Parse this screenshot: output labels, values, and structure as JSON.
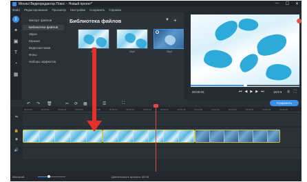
{
  "window": {
    "title": "Movavi Видеоредактор Плюс – Новый проект*",
    "controls": [
      "—",
      "☐",
      "✕"
    ]
  },
  "menu": [
    "Файл",
    "Редактирование",
    "Просмотр",
    "Настройки",
    "Сохранить",
    "Справка"
  ],
  "tools": [
    "import-icon",
    "magic-wand-icon",
    "filters-icon",
    "titles-icon",
    "transitions-icon",
    "stickers-icon"
  ],
  "categories": {
    "items": [
      "Импорт файлов",
      "Библиотека файлов",
      "Звуки",
      "Музыка",
      "Видеозаставки",
      "Фоны",
      "Наборы эффектов"
    ],
    "active_index": 1
  },
  "library": {
    "title": "Библиотека файлов",
    "filter_glyph": "▼",
    "add_glyph": "+",
    "items": [
      {
        "label": "Clip1",
        "selected": false
      },
      {
        "label": "Clip2",
        "selected": false
      },
      {
        "label": "Clip3",
        "selected": true
      }
    ]
  },
  "preview": {
    "timecode": "00:00:02.",
    "transport": [
      "⏮",
      "◀",
      "▶",
      "▶",
      "⏭"
    ],
    "aspect_ratio": "16:9 ▾",
    "position_fraction": 0.5
  },
  "timeline_toolbar": {
    "tools": [
      "↶",
      "↷",
      "🗑",
      "✂",
      "⟳",
      "▦",
      "◐",
      "☰",
      "⛶"
    ],
    "save_label": "Сохранить"
  },
  "ruler": {
    "ticks": [
      "00:00:00",
      "00:00:02",
      "00:00:04",
      "00:00:06",
      "00:00:08",
      "00:00:10",
      "00:00:12",
      "00:00:14",
      "00:00:16",
      "00:00:18",
      "00:00:20",
      "00:00:22",
      "00:00:24",
      "00:00:26",
      "00:00:28",
      "00:00:30"
    ]
  },
  "statusbar": {
    "zoom_label": "Масштаб:",
    "zoom_fraction": 0.4,
    "duration": "Длительность проекта: 00:08"
  },
  "colors": {
    "accent": "#3a8fe6",
    "clip_border": "#d4c84a",
    "playhead": "#e24a4a",
    "annotation_arrow": "#e6302b"
  }
}
